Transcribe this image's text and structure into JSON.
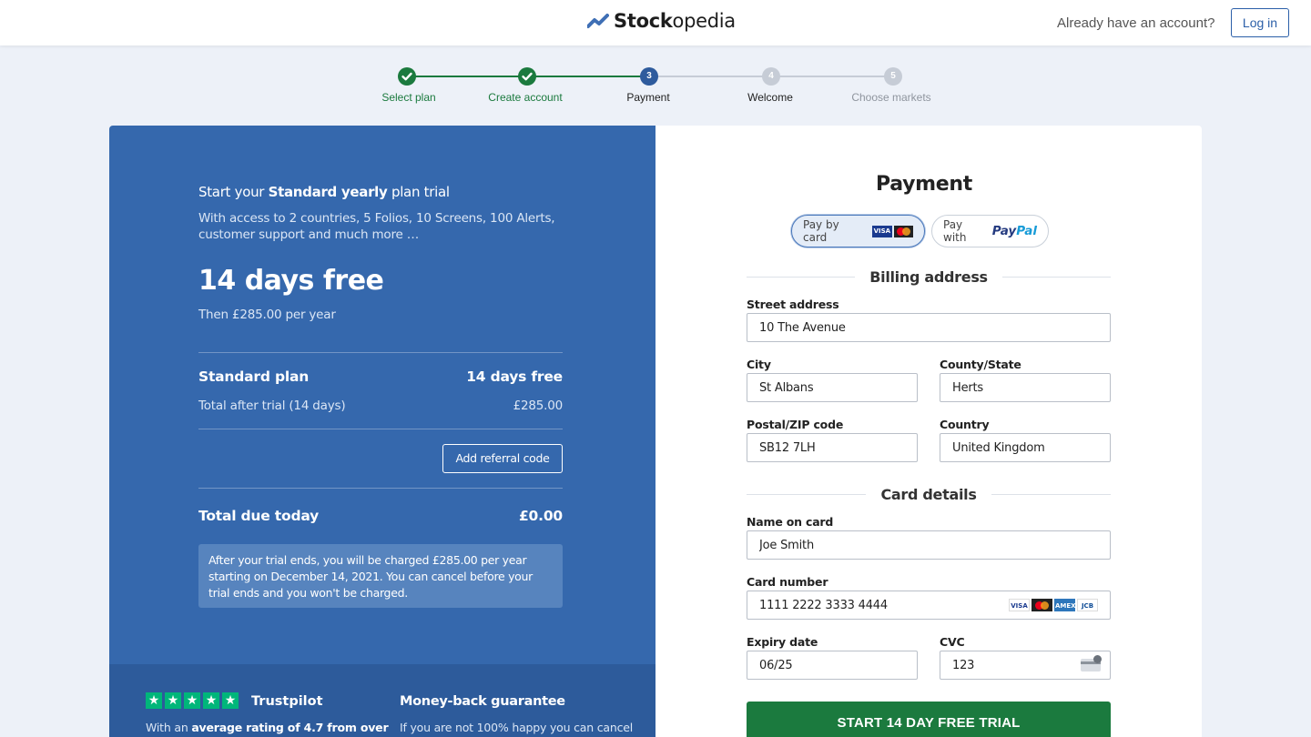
{
  "header": {
    "brand_strong": "Stock",
    "brand_rest": "opedia",
    "already_text": "Already have an account?",
    "login_label": "Log in"
  },
  "stepper": {
    "steps": [
      {
        "label": "Select plan",
        "state": "done"
      },
      {
        "label": "Create account",
        "state": "done"
      },
      {
        "label": "Payment",
        "state": "active",
        "num": "3"
      },
      {
        "label": "Welcome",
        "state": "next",
        "num": "4"
      },
      {
        "label": "Choose markets",
        "state": "todo",
        "num": "5"
      }
    ]
  },
  "plan": {
    "intro_pre": "Start your ",
    "intro_bold": "Standard yearly",
    "intro_post": " plan trial",
    "access_text": "With access to 2 countries, 5 Folios, 10 Screens, 100 Alerts, customer support and much more …",
    "headline": "14 days free",
    "then_text": "Then £285.00 per year",
    "plan_name": "Standard plan",
    "plan_trial": "14 days free",
    "after_trial_label": "Total after trial (14 days)",
    "after_trial_value": "£285.00",
    "referral_label": "Add referral code",
    "due_label": "Total due today",
    "due_value": "£0.00",
    "notice": "After your trial ends, you will be charged £285.00 per year starting on December 14, 2021. You can cancel before your trial ends and you won't be charged."
  },
  "trust": {
    "trustpilot_label": "Trustpilot",
    "trustpilot_text_pre": "With an ",
    "trustpilot_text_bold": "average rating of 4.7 from over",
    "guarantee_label": "Money-back guarantee",
    "guarantee_text": "If you are not 100% happy you can cancel"
  },
  "payment": {
    "title": "Payment",
    "card_tab": "Pay by card",
    "paypal_tab_pre": "Pay with",
    "paypal_p1": "Pay",
    "paypal_p2": "Pal",
    "billing_heading": "Billing address",
    "street_label": "Street address",
    "street_value": "10 The Avenue",
    "city_label": "City",
    "city_value": "St Albans",
    "county_label": "County/State",
    "county_value": "Herts",
    "postal_label": "Postal/ZIP code",
    "postal_value": "SB12 7LH",
    "country_label": "Country",
    "country_value": "United Kingdom",
    "card_heading": "Card details",
    "name_label": "Name on card",
    "name_value": "Joe Smith",
    "number_label": "Card number",
    "number_value": "1111 2222 3333 4444",
    "expiry_label": "Expiry date",
    "expiry_value": "06/25",
    "cvc_label": "CVC",
    "cvc_value": "123",
    "cta_label": "START 14 DAY FREE TRIAL",
    "card_brand_visa": "VISA",
    "card_brand_amex": "AMEX",
    "card_brand_jcb": "JCB"
  },
  "colors": {
    "brand_blue": "#3568ad",
    "success_green": "#1b7a3e",
    "background": "#edf1f8"
  }
}
